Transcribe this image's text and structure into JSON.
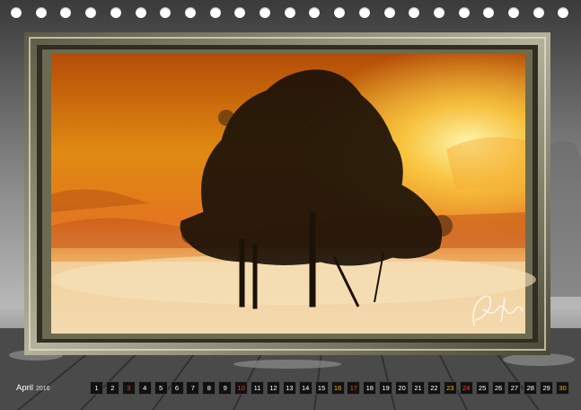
{
  "palette": {
    "hole": "#ffffff",
    "sky_top": "#c2570a",
    "sky_mid": "#e48a12",
    "sun": "#fff2a0",
    "fog": "#f1c98a",
    "frame_gold": "#8c8a6a",
    "day_normal": "#ffffff",
    "day_sunday": "#ff3b1f",
    "day_holiday": "#ffb400"
  },
  "calendar": {
    "month": "April",
    "year": "2016",
    "days": [
      {
        "n": "1",
        "kind": "normal"
      },
      {
        "n": "2",
        "kind": "normal"
      },
      {
        "n": "3",
        "kind": "sun"
      },
      {
        "n": "4",
        "kind": "normal"
      },
      {
        "n": "5",
        "kind": "normal"
      },
      {
        "n": "6",
        "kind": "normal"
      },
      {
        "n": "7",
        "kind": "normal"
      },
      {
        "n": "8",
        "kind": "normal"
      },
      {
        "n": "9",
        "kind": "normal"
      },
      {
        "n": "10",
        "kind": "sun"
      },
      {
        "n": "11",
        "kind": "normal"
      },
      {
        "n": "12",
        "kind": "normal"
      },
      {
        "n": "13",
        "kind": "normal"
      },
      {
        "n": "14",
        "kind": "normal"
      },
      {
        "n": "15",
        "kind": "normal"
      },
      {
        "n": "16",
        "kind": "hol"
      },
      {
        "n": "17",
        "kind": "sun"
      },
      {
        "n": "18",
        "kind": "normal"
      },
      {
        "n": "19",
        "kind": "normal"
      },
      {
        "n": "20",
        "kind": "normal"
      },
      {
        "n": "21",
        "kind": "normal"
      },
      {
        "n": "22",
        "kind": "normal"
      },
      {
        "n": "23",
        "kind": "hol"
      },
      {
        "n": "24",
        "kind": "sun"
      },
      {
        "n": "25",
        "kind": "normal"
      },
      {
        "n": "26",
        "kind": "normal"
      },
      {
        "n": "27",
        "kind": "normal"
      },
      {
        "n": "28",
        "kind": "normal"
      },
      {
        "n": "29",
        "kind": "normal"
      },
      {
        "n": "30",
        "kind": "hol"
      }
    ]
  },
  "signature": "Kh Pöchs"
}
